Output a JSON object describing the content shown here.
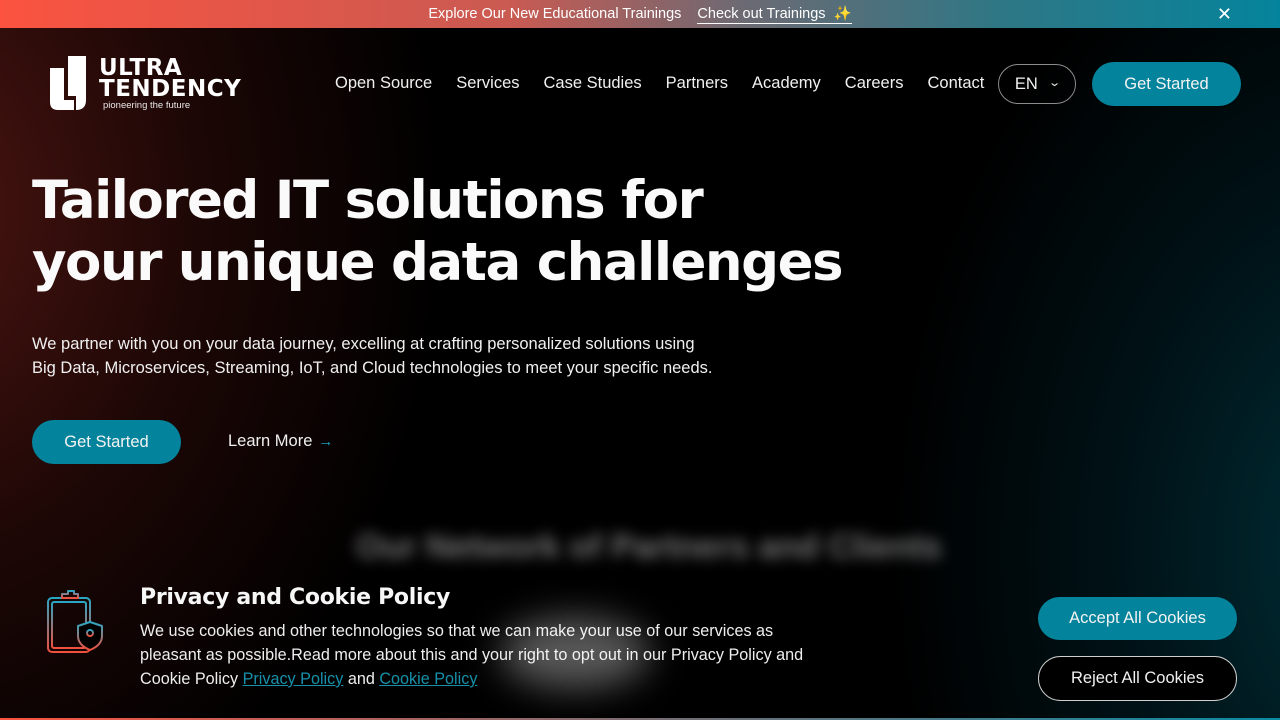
{
  "promo": {
    "text": "Explore Our New Educational Trainings",
    "link_label": "Check out Trainings",
    "sparkle": "✨",
    "close": "✕"
  },
  "header": {
    "logo": {
      "line1": "ULTRA",
      "line2": "TENDENCY",
      "tagline": "pioneering the future"
    },
    "nav": [
      {
        "label": "Open Source"
      },
      {
        "label": "Services"
      },
      {
        "label": "Case Studies"
      },
      {
        "label": "Partners"
      },
      {
        "label": "Academy"
      },
      {
        "label": "Careers"
      },
      {
        "label": "Contact"
      }
    ],
    "language": {
      "selected": "EN",
      "chevron": "⌄"
    },
    "cta_label": "Get Started"
  },
  "hero": {
    "title_lines": [
      "Tailored IT solutions for",
      "your unique data challenges"
    ],
    "subtitle_lines": [
      "We partner with you on your data journey, excelling at crafting personalized solutions using",
      "Big Data, Microservices, Streaming, IoT, and Cloud technologies to meet your specific needs."
    ],
    "primary_cta": "Get Started",
    "secondary_cta": "Learn More",
    "secondary_arrow": "→",
    "blurred_heading": "Our Network of Partners and Clients"
  },
  "cookie": {
    "title": "Privacy and Cookie Policy",
    "line1": "We use cookies and other technologies so that we can make your use of our services as",
    "line2": "pleasant as possible.Read more about this and your right to opt out in our Privacy Policy and",
    "line3_prefix": "Cookie Policy ",
    "privacy_link": "Privacy Policy",
    "and": " and ",
    "cookie_link": "Cookie Policy",
    "accept_label": "Accept All Cookies",
    "reject_label": "Reject All Cookies"
  },
  "colors": {
    "accent": "#04849c",
    "promo_start": "#fb5340",
    "promo_end": "#04849c",
    "link": "#1791ab"
  }
}
